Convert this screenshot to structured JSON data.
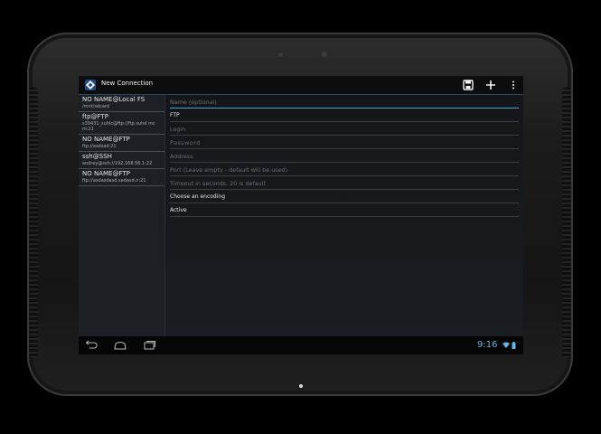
{
  "action_bar": {
    "title": "New Connection",
    "app_icon": "app-logo-icon",
    "actions": [
      {
        "name": "save",
        "icon": "save-icon"
      },
      {
        "name": "add",
        "icon": "plus-icon"
      },
      {
        "name": "more",
        "icon": "overflow-menu-icon"
      }
    ]
  },
  "connections": [
    {
      "name": "NO NAME@Local FS",
      "path": "/mnt/sdcard"
    },
    {
      "name": "ftp@FTP",
      "path": "s39431_suhlc@ftp://ftp.suhd mcm:21"
    },
    {
      "name": "NO NAME@FTP",
      "path": "ftp://asdsad:21"
    },
    {
      "name": "ssh@SSH",
      "path": "andrey@ssh://192.168.56.1:22"
    },
    {
      "name": "NO NAME@FTP",
      "path": "ftp://asdasdasd.sadasd.n:21"
    }
  ],
  "form": {
    "name_placeholder": "Name (optional)",
    "type_value": "FTP",
    "login_placeholder": "Login",
    "password_placeholder": "Password",
    "address_placeholder": "Address",
    "port_placeholder": "Port (Leave empty - default will be used)",
    "timeout_placeholder": "Timeout in seconds. 20 is default",
    "encoding_label": "Choose an encoding",
    "mode_label": "Active"
  },
  "nav_bar": {
    "time": "9:16",
    "buttons": [
      "back-icon",
      "home-icon",
      "recents-icon"
    ],
    "status_icons": [
      "wifi-icon",
      "battery-icon"
    ]
  },
  "colors": {
    "accent": "#3ea8d8",
    "clock": "#5fb7e3"
  }
}
